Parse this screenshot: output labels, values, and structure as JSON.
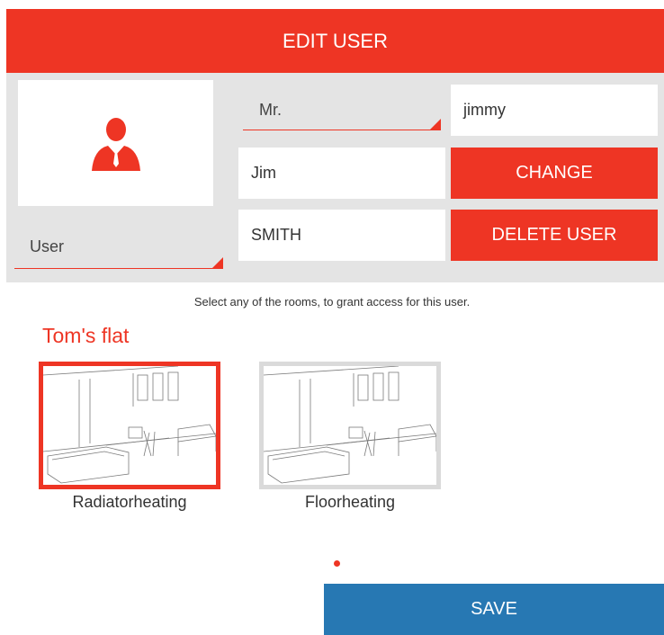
{
  "header": {
    "title": "EDIT USER"
  },
  "form": {
    "role_value": "User",
    "salutation_value": "Mr.",
    "username_value": "jimmy",
    "first_name_value": "Jim",
    "last_name_value": "SMITH",
    "change_label": "CHANGE",
    "delete_label": "DELETE USER"
  },
  "rooms_section": {
    "hint": "Select any of the rooms, to grant access for this user.",
    "group_title": "Tom's flat",
    "rooms": [
      {
        "label": "Radiatorheating",
        "selected": true
      },
      {
        "label": "Floorheating",
        "selected": false
      }
    ]
  },
  "footer": {
    "save_label": "SAVE"
  },
  "icons": {
    "avatar": "user-avatar-icon",
    "room": "living-room-sketch"
  },
  "colors": {
    "accent": "#ee3524",
    "primary": "#2778b3",
    "panel": "#e4e4e4"
  }
}
